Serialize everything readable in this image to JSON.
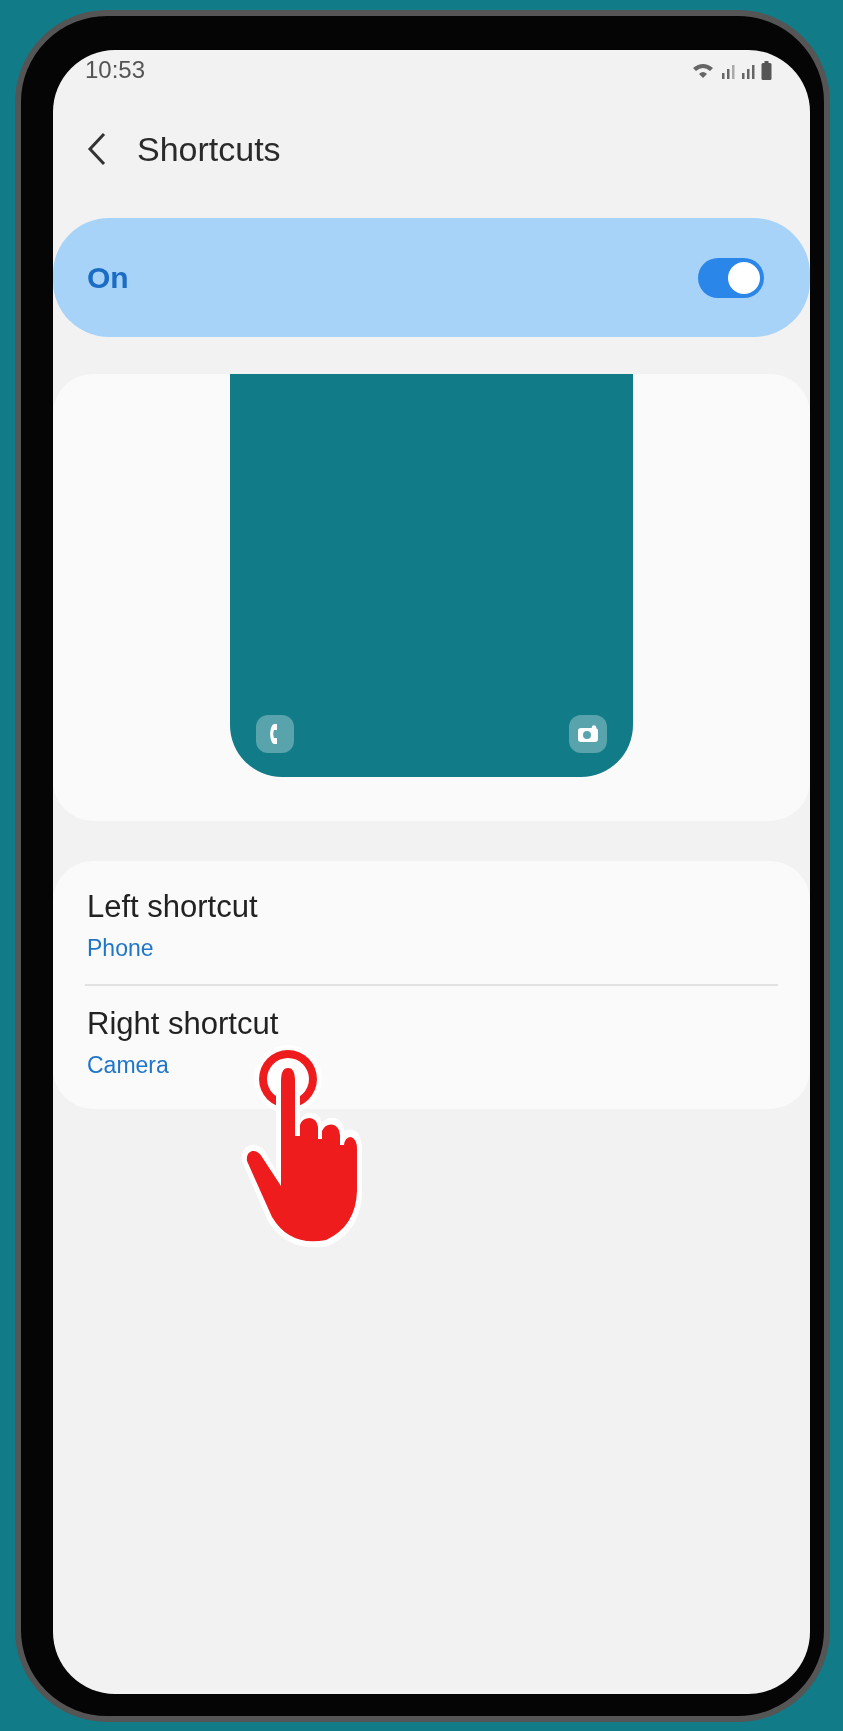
{
  "status_bar": {
    "time": "10:53"
  },
  "header": {
    "title": "Shortcuts"
  },
  "master_switch": {
    "label": "On",
    "on": true
  },
  "shortcuts": [
    {
      "title": "Left shortcut",
      "value": "Phone",
      "kind": "phone"
    },
    {
      "title": "Right shortcut",
      "value": "Camera",
      "kind": "camera"
    }
  ]
}
